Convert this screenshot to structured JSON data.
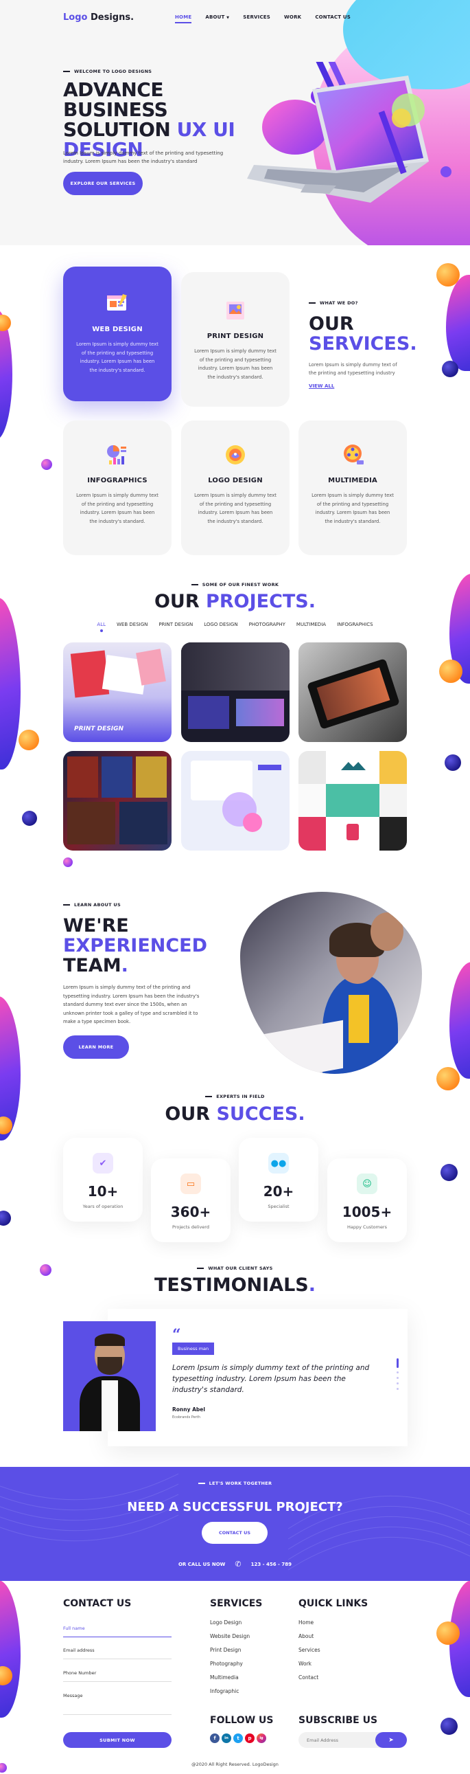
{
  "brand": {
    "logo_part1": "Logo",
    "logo_part2": " Designs."
  },
  "nav": {
    "items": [
      "HOME",
      "ABOUT",
      "SERVICES",
      "WORK",
      "CONTACT US"
    ],
    "active": "HOME",
    "about_has_dropdown": true
  },
  "hero": {
    "eyebrow": "WELCOME TO LOGO DESIGNS",
    "title_line1": "ADVANCE BUSINESS",
    "title_line2a": "SOLUTION ",
    "title_line2b": "UX UI",
    "title_line3": "DESIGN",
    "text": "Lorem Ipsum is simply dummy text of the printing and typesetting industry. Lorem Ipsum has been the industry's standard",
    "button": "EXPLORE OUR SERVICES"
  },
  "services": {
    "eyebrow": "WHAT WE DO?",
    "title_line1": "OUR",
    "title_line2": "SERVICES",
    "text": "Lorem Ipsum is simply dummy text of the printing and typesetting industry",
    "link": "VIEW ALL",
    "cards": [
      {
        "title": "WEB DESIGN",
        "text": "Lorem Ipsum is simply dummy text of the printing and typesetting industry. Lorem Ipsum has been the industry's standard.",
        "icon": "web-design-icon"
      },
      {
        "title": "PRINT DESIGN",
        "text": "Lorem Ipsum is simply dummy text of the printing and typesetting industry. Lorem Ipsum has been the industry's standard.",
        "icon": "print-design-icon"
      },
      {
        "title": "INFOGRAPHICS",
        "text": "Lorem Ipsum is simply dummy text of the printing and typesetting industry. Lorem Ipsum has been the industry's standard.",
        "icon": "infographics-icon"
      },
      {
        "title": "LOGO DESIGN",
        "text": "Lorem Ipsum is simply dummy text of the printing and typesetting industry. Lorem Ipsum has been the industry's standard.",
        "icon": "logo-design-icon"
      },
      {
        "title": "MULTIMEDIA",
        "text": "Lorem Ipsum is simply dummy text of the printing and typesetting industry. Lorem Ipsum has been the industry's standard.",
        "icon": "multimedia-icon"
      }
    ]
  },
  "projects": {
    "eyebrow": "SOME OF OUR FINEST WORK",
    "title_a": "OUR ",
    "title_b": "PROJECTS",
    "filters": [
      "ALL",
      "WEB DESIGN",
      "PRINT DESIGN",
      "LOGO DESIGN",
      "PHOTOGRAPHY",
      "MULTIMEDIA",
      "INFOGRAPHICS"
    ],
    "active_filter": "ALL",
    "first_caption": "PRINT DESIGN"
  },
  "about": {
    "eyebrow": "LEARN ABOUT US",
    "title_line1": "WE'RE",
    "title_line2": "EXPERIENCED",
    "title_line3": "TEAM",
    "text": "Lorem Ipsum is simply dummy text of the printing and typesetting industry. Lorem Ipsum has been the industry's standard dummy text ever since the 1500s, when an unknown printer took a galley of type and scrambled it to make a type specimen book.",
    "button": "LEARN MORE"
  },
  "stats": {
    "eyebrow": "EXPERTS IN FIELD",
    "title_a": "OUR ",
    "title_b": "SUCCES",
    "items": [
      {
        "number": "10+",
        "label": "Years of operation",
        "icon": "calendar-check-icon",
        "color": "#8b5cf6"
      },
      {
        "number": "360+",
        "label": "Projects deliverd",
        "icon": "monitor-icon",
        "color": "#f97316"
      },
      {
        "number": "20+",
        "label": "Specialist",
        "icon": "team-icon",
        "color": "#0ea5e9"
      },
      {
        "number": "1005+",
        "label": "Happy Customers",
        "icon": "happy-customer-icon",
        "color": "#10b981"
      }
    ]
  },
  "testimonials": {
    "eyebrow": "WHAT OUR CLIENT SAYS",
    "title": "TESTIMONIALS",
    "badge": "Business man",
    "quote": "Lorem Ipsum is simply dummy text of the printing and typesetting industry. Lorem Ipsum has been the industry's standard.",
    "name": "Ronny Abel",
    "role": "Ecobrands Perth"
  },
  "cta": {
    "eyebrow": "LET'S WORK TOGETHER",
    "title": "NEED A SUCCESSFUL PROJECT?",
    "button": "CONTACT US",
    "call_label": "OR CALL US NOW",
    "phone": "123 - 456 - 789"
  },
  "footer": {
    "contact_title": "CONTACT US",
    "fields": [
      "Full name",
      "Email address",
      "Phone Number",
      "Message"
    ],
    "submit": "SUBMIT NOW",
    "services_title": "SERVICES",
    "services": [
      "Logo Design",
      "Website Design",
      "Print Design",
      "Photography",
      "Multimedia",
      "Infographic"
    ],
    "links_title": "QUICK LINKS",
    "links": [
      "Home",
      "About",
      "Services",
      "Work",
      "Contact"
    ],
    "follow_title": "FOLLOW US",
    "social": [
      "f",
      "in",
      "t",
      "p",
      "ig"
    ],
    "subscribe_title": "SUBSCRIBE US",
    "email_placeholder": "Email Address",
    "copyright": "@2020 All Right Reserved. LogoDesign"
  },
  "colors": {
    "accent": "#5b4fe6",
    "dark": "#1d1d2b"
  }
}
